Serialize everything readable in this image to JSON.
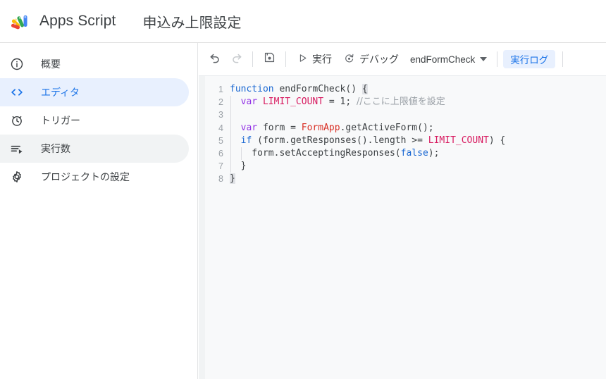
{
  "header": {
    "logo_icon": "apps-script-logo-icon",
    "app_name": "Apps Script",
    "project_title": "申込み上限設定"
  },
  "sidebar": {
    "items": [
      {
        "label": "概要",
        "icon": "info-circle-icon",
        "state": "normal"
      },
      {
        "label": "エディタ",
        "icon": "code-brackets-icon",
        "state": "selected"
      },
      {
        "label": "トリガー",
        "icon": "alarm-clock-icon",
        "state": "normal"
      },
      {
        "label": "実行数",
        "icon": "executions-list-play-icon",
        "state": "hovered"
      },
      {
        "label": "プロジェクトの設定",
        "icon": "gear-icon",
        "state": "normal"
      }
    ]
  },
  "toolbar": {
    "undo_icon": "undo-arrow-icon",
    "redo_icon": "redo-arrow-icon",
    "save_icon": "save-floppy-icon",
    "run_icon": "play-triangle-icon",
    "run_label": "実行",
    "debug_icon": "debug-step-icon",
    "debug_label": "デバッグ",
    "function_select_value": "endFormCheck",
    "function_select_caret_icon": "chevron-down-icon",
    "execution_log_label": "実行ログ"
  },
  "editor": {
    "accent_blue": "#1a73e8",
    "accent_blue_bg": "#e8f0fe",
    "background": "#f8f9fa",
    "lines": [
      {
        "number": "1",
        "indent": 0,
        "tokens": [
          {
            "t": "function",
            "c": "t-kw"
          },
          {
            "t": " ",
            "c": "t-plain"
          },
          {
            "t": "endFormCheck",
            "c": "t-plain"
          },
          {
            "t": "() ",
            "c": "t-plain"
          },
          {
            "t": "{",
            "c": "t-plain t-match"
          }
        ]
      },
      {
        "number": "2",
        "indent": 1,
        "tokens": [
          {
            "t": "  ",
            "c": "t-plain"
          },
          {
            "t": "var",
            "c": "t-var"
          },
          {
            "t": " ",
            "c": "t-plain"
          },
          {
            "t": "LIMIT_COUNT",
            "c": "t-const"
          },
          {
            "t": " = ",
            "c": "t-plain"
          },
          {
            "t": "1",
            "c": "t-num"
          },
          {
            "t": "; ",
            "c": "t-plain"
          },
          {
            "t": "//ここに上限値を設定",
            "c": "t-cmt"
          }
        ]
      },
      {
        "number": "3",
        "indent": 1,
        "tokens": [
          {
            "t": "",
            "c": "t-plain"
          }
        ]
      },
      {
        "number": "4",
        "indent": 1,
        "tokens": [
          {
            "t": "  ",
            "c": "t-plain"
          },
          {
            "t": "var",
            "c": "t-var"
          },
          {
            "t": " form = ",
            "c": "t-plain"
          },
          {
            "t": "FormApp",
            "c": "t-cls"
          },
          {
            "t": ".getActiveForm();",
            "c": "t-plain"
          }
        ]
      },
      {
        "number": "5",
        "indent": 1,
        "tokens": [
          {
            "t": "  ",
            "c": "t-plain"
          },
          {
            "t": "if",
            "c": "t-kw"
          },
          {
            "t": " (form.getResponses().length >= ",
            "c": "t-plain"
          },
          {
            "t": "LIMIT_COUNT",
            "c": "t-const"
          },
          {
            "t": ") {",
            "c": "t-plain"
          }
        ]
      },
      {
        "number": "6",
        "indent": 2,
        "tokens": [
          {
            "t": "    form.setAcceptingResponses(",
            "c": "t-plain"
          },
          {
            "t": "false",
            "c": "t-bool"
          },
          {
            "t": ");",
            "c": "t-plain"
          }
        ]
      },
      {
        "number": "7",
        "indent": 1,
        "tokens": [
          {
            "t": "  }",
            "c": "t-plain"
          }
        ]
      },
      {
        "number": "8",
        "indent": 0,
        "tokens": [
          {
            "t": "}",
            "c": "t-plain t-match"
          }
        ]
      }
    ]
  }
}
